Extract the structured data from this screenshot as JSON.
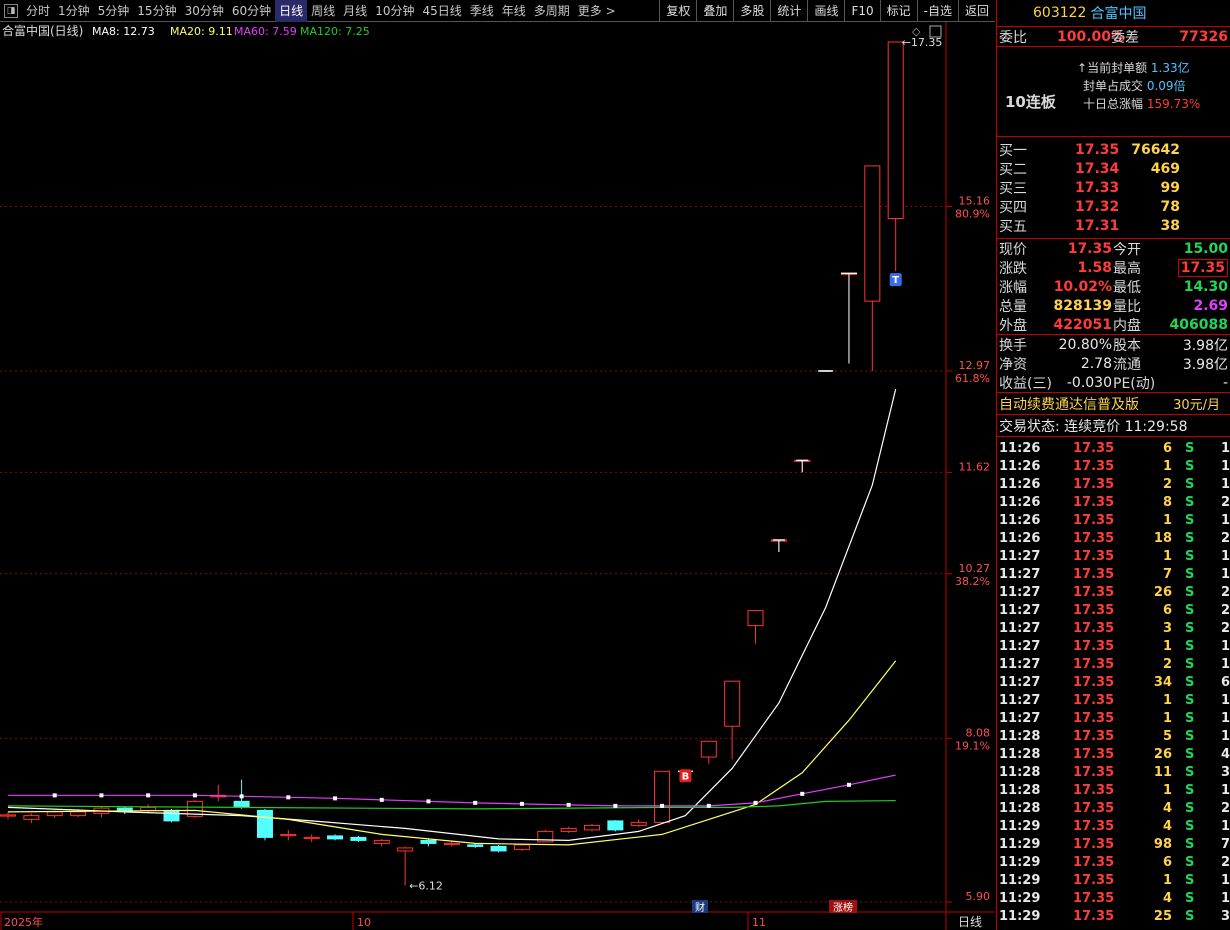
{
  "toolbar": {
    "periods": [
      "分时",
      "1分钟",
      "5分钟",
      "15分钟",
      "30分钟",
      "60分钟",
      "日线",
      "周线",
      "月线",
      "10分钟",
      "45日线",
      "季线",
      "年线",
      "多周期",
      "更多 >"
    ],
    "active_period": "日线",
    "tools": [
      "复权",
      "叠加",
      "多股",
      "统计",
      "画线",
      "F10",
      "标记",
      "-自选",
      "返回"
    ]
  },
  "chart_header": {
    "name": "合富中国(日线)",
    "ma8": "MA8: 12.73",
    "ma20": "MA20: 9.11",
    "ma60": "MA60: 7.59",
    "ma120": "MA120: 7.25"
  },
  "chart_data": {
    "type": "candlestick",
    "ylim": [
      5.9,
      17.35
    ],
    "price_ticks": [
      {
        "v": 15.16,
        "label": "15.16",
        "pct": "80.9%"
      },
      {
        "v": 12.97,
        "label": "12.97",
        "pct": "61.8%"
      },
      {
        "v": 11.62,
        "label": "11.62",
        "pct": ""
      },
      {
        "v": 10.27,
        "label": "10.27",
        "pct": "38.2%"
      },
      {
        "v": 8.08,
        "label": "8.08",
        "pct": "19.1%"
      },
      {
        "v": 5.9,
        "label": "5.90",
        "pct": ""
      }
    ],
    "x_labels": [
      "2025年",
      "10",
      "11"
    ],
    "period_label": "日线",
    "candles": [
      {
        "o": 7.06,
        "c": 7.06,
        "h": 7.1,
        "l": 7.0
      },
      {
        "o": 7.0,
        "c": 7.05,
        "h": 7.08,
        "l": 6.95
      },
      {
        "o": 7.05,
        "c": 7.1,
        "h": 7.12,
        "l": 7.02
      },
      {
        "o": 7.05,
        "c": 7.1,
        "h": 7.14,
        "l": 7.03
      },
      {
        "o": 7.08,
        "c": 7.15,
        "h": 7.17,
        "l": 7.03
      },
      {
        "o": 7.15,
        "c": 7.12,
        "h": 7.17,
        "l": 7.07
      },
      {
        "o": 7.12,
        "c": 7.16,
        "h": 7.2,
        "l": 7.08
      },
      {
        "o": 7.12,
        "c": 6.98,
        "h": 7.14,
        "l": 6.96
      },
      {
        "o": 7.04,
        "c": 7.24,
        "h": 7.26,
        "l": 7.02
      },
      {
        "o": 7.3,
        "c": 7.32,
        "h": 7.46,
        "l": 7.24
      },
      {
        "o": 7.24,
        "c": 7.16,
        "h": 7.53,
        "l": 7.14
      },
      {
        "o": 7.12,
        "c": 6.76,
        "h": 7.14,
        "l": 6.72
      },
      {
        "o": 6.8,
        "c": 6.8,
        "h": 6.86,
        "l": 6.72
      },
      {
        "o": 6.76,
        "c": 6.76,
        "h": 6.8,
        "l": 6.7
      },
      {
        "o": 6.78,
        "c": 6.74,
        "h": 6.8,
        "l": 6.72
      },
      {
        "o": 6.76,
        "c": 6.72,
        "h": 6.78,
        "l": 6.7
      },
      {
        "o": 6.68,
        "c": 6.72,
        "h": 6.74,
        "l": 6.64
      },
      {
        "o": 6.58,
        "c": 6.62,
        "h": 6.64,
        "l": 6.12
      },
      {
        "o": 6.72,
        "c": 6.68,
        "h": 6.74,
        "l": 6.64
      },
      {
        "o": 6.68,
        "c": 6.68,
        "h": 6.72,
        "l": 6.64
      },
      {
        "o": 6.66,
        "c": 6.64,
        "h": 6.68,
        "l": 6.62
      },
      {
        "o": 6.64,
        "c": 6.58,
        "h": 6.66,
        "l": 6.56
      },
      {
        "o": 6.6,
        "c": 6.66,
        "h": 6.68,
        "l": 6.58
      },
      {
        "o": 6.7,
        "c": 6.84,
        "h": 6.86,
        "l": 6.7
      },
      {
        "o": 6.84,
        "c": 6.88,
        "h": 6.9,
        "l": 6.82
      },
      {
        "o": 6.86,
        "c": 6.92,
        "h": 6.94,
        "l": 6.84
      },
      {
        "o": 6.98,
        "c": 6.86,
        "h": 6.99,
        "l": 6.84
      },
      {
        "o": 6.92,
        "c": 6.96,
        "h": 7.0,
        "l": 6.9
      },
      {
        "o": 6.96,
        "c": 7.64,
        "h": 7.64,
        "l": 6.96
      },
      {
        "o": 7.64,
        "c": 7.64,
        "h": 7.64,
        "l": 7.64
      },
      {
        "o": 7.83,
        "c": 8.04,
        "h": 8.04,
        "l": 7.74
      },
      {
        "o": 8.24,
        "c": 8.84,
        "h": 8.84,
        "l": 7.8
      },
      {
        "o": 9.58,
        "c": 9.78,
        "h": 9.78,
        "l": 9.34
      },
      {
        "o": 10.72,
        "c": 10.72,
        "h": 10.72,
        "l": 10.56
      },
      {
        "o": 11.78,
        "c": 11.78,
        "h": 11.78,
        "l": 11.62
      },
      {
        "o": 12.97,
        "c": 12.97,
        "h": 12.97,
        "l": 12.97
      },
      {
        "o": 14.27,
        "c": 14.27,
        "h": 14.27,
        "l": 13.07
      },
      {
        "o": 13.9,
        "c": 15.7,
        "h": 15.7,
        "l": 12.97
      },
      {
        "o": 15.0,
        "c": 17.35,
        "h": 17.35,
        "l": 14.3
      }
    ],
    "ma_lines": [
      {
        "name": "MA8",
        "color": "#ffffff",
        "points": [
          [
            0,
            7.16
          ],
          [
            5,
            7.1
          ],
          [
            10,
            7.05
          ],
          [
            13,
            6.98
          ],
          [
            17,
            6.88
          ],
          [
            21,
            6.74
          ],
          [
            24,
            6.72
          ],
          [
            27,
            6.84
          ],
          [
            29,
            7.05
          ],
          [
            31,
            7.68
          ],
          [
            33,
            8.55
          ],
          [
            35,
            9.82
          ],
          [
            37,
            11.45
          ],
          [
            38,
            12.73
          ]
        ]
      },
      {
        "name": "MA20",
        "color": "#ffff66",
        "points": [
          [
            0,
            7.1
          ],
          [
            8,
            7.12
          ],
          [
            12,
            7.0
          ],
          [
            16,
            6.8
          ],
          [
            20,
            6.68
          ],
          [
            24,
            6.66
          ],
          [
            28,
            6.8
          ],
          [
            30,
            7.0
          ],
          [
            32,
            7.2
          ],
          [
            34,
            7.62
          ],
          [
            36,
            8.32
          ],
          [
            38,
            9.11
          ]
        ]
      },
      {
        "name": "MA60",
        "color": "#e040fb",
        "points": [
          [
            0,
            7.32
          ],
          [
            8,
            7.32
          ],
          [
            14,
            7.28
          ],
          [
            20,
            7.22
          ],
          [
            26,
            7.18
          ],
          [
            30,
            7.18
          ],
          [
            32,
            7.22
          ],
          [
            34,
            7.34
          ],
          [
            36,
            7.46
          ],
          [
            38,
            7.59
          ]
        ]
      },
      {
        "name": "MA120",
        "color": "#22cc22",
        "points": [
          [
            0,
            7.18
          ],
          [
            10,
            7.16
          ],
          [
            20,
            7.14
          ],
          [
            28,
            7.16
          ],
          [
            31,
            7.16
          ],
          [
            33,
            7.18
          ],
          [
            35,
            7.24
          ],
          [
            38,
            7.25
          ]
        ]
      }
    ],
    "annotations": {
      "high": "17.35",
      "low": "6.12",
      "b_marker": "B",
      "t_marker": "T",
      "cai": "财",
      "zhangbang": "涨榜"
    }
  },
  "panel": {
    "code": "603122",
    "name": "合富中国",
    "webi_label": "委比",
    "webi": "100.00%",
    "weicha_label": "委差",
    "weicha": "77326",
    "seal_amt_label": "当前封单额",
    "seal_amt": "1.33亿",
    "seal_ratio_label": "封单占成交",
    "seal_ratio": "0.09倍",
    "tenday_label": "十日总涨幅",
    "tenday": "159.73%",
    "lianban": "10连板",
    "bids": [
      {
        "label": "买一",
        "price": "17.35",
        "vol": "76642"
      },
      {
        "label": "买二",
        "price": "17.34",
        "vol": "469"
      },
      {
        "label": "买三",
        "price": "17.33",
        "vol": "99"
      },
      {
        "label": "买四",
        "price": "17.32",
        "vol": "78"
      },
      {
        "label": "买五",
        "price": "17.31",
        "vol": "38"
      }
    ],
    "q": [
      {
        "l1": "现价",
        "v1": "17.35",
        "c1": "red",
        "l2": "今开",
        "v2": "15.00",
        "c2": "green"
      },
      {
        "l1": "涨跌",
        "v1": "1.58",
        "c1": "red",
        "l2": "最高",
        "v2": "17.35",
        "c2": "red"
      },
      {
        "l1": "涨幅",
        "v1": "10.02%",
        "c1": "red",
        "l2": "最低",
        "v2": "14.30",
        "c2": "green"
      },
      {
        "l1": "总量",
        "v1": "828139",
        "c1": "yel",
        "l2": "量比",
        "v2": "2.69",
        "c2": "mag"
      },
      {
        "l1": "外盘",
        "v1": "422051",
        "c1": "red",
        "l2": "内盘",
        "v2": "406088",
        "c2": "green"
      }
    ],
    "f": [
      {
        "l1": "换手",
        "v1": "20.80%",
        "l2": "股本",
        "v2": "3.98亿"
      },
      {
        "l1": "净资",
        "v1": "2.78",
        "l2": "流通",
        "v2": "3.98亿"
      },
      {
        "l1": "收益(三)",
        "v1": "-0.030",
        "l2": "PE(动)",
        "v2": "-"
      }
    ],
    "promo": "自动续费通达信普及版",
    "promo_price": "30元/月",
    "trade_state": "交易状态: 连续竞价 11:29:58",
    "ticks": [
      [
        "11:26",
        "17.35",
        "6",
        "S",
        "1"
      ],
      [
        "11:26",
        "17.35",
        "1",
        "S",
        "1"
      ],
      [
        "11:26",
        "17.35",
        "2",
        "S",
        "1"
      ],
      [
        "11:26",
        "17.35",
        "8",
        "S",
        "2"
      ],
      [
        "11:26",
        "17.35",
        "1",
        "S",
        "1"
      ],
      [
        "11:26",
        "17.35",
        "18",
        "S",
        "2"
      ],
      [
        "11:27",
        "17.35",
        "1",
        "S",
        "1"
      ],
      [
        "11:27",
        "17.35",
        "7",
        "S",
        "1"
      ],
      [
        "11:27",
        "17.35",
        "26",
        "S",
        "2"
      ],
      [
        "11:27",
        "17.35",
        "6",
        "S",
        "2"
      ],
      [
        "11:27",
        "17.35",
        "3",
        "S",
        "2"
      ],
      [
        "11:27",
        "17.35",
        "1",
        "S",
        "1"
      ],
      [
        "11:27",
        "17.35",
        "2",
        "S",
        "1"
      ],
      [
        "11:27",
        "17.35",
        "34",
        "S",
        "6"
      ],
      [
        "11:27",
        "17.35",
        "1",
        "S",
        "1"
      ],
      [
        "11:27",
        "17.35",
        "1",
        "S",
        "1"
      ],
      [
        "11:28",
        "17.35",
        "5",
        "S",
        "1"
      ],
      [
        "11:28",
        "17.35",
        "26",
        "S",
        "4"
      ],
      [
        "11:28",
        "17.35",
        "11",
        "S",
        "3"
      ],
      [
        "11:28",
        "17.35",
        "1",
        "S",
        "1"
      ],
      [
        "11:28",
        "17.35",
        "4",
        "S",
        "2"
      ],
      [
        "11:29",
        "17.35",
        "4",
        "S",
        "1"
      ],
      [
        "11:29",
        "17.35",
        "98",
        "S",
        "7"
      ],
      [
        "11:29",
        "17.35",
        "6",
        "S",
        "2"
      ],
      [
        "11:29",
        "17.35",
        "1",
        "S",
        "1"
      ],
      [
        "11:29",
        "17.35",
        "4",
        "S",
        "1"
      ],
      [
        "11:29",
        "17.35",
        "25",
        "S",
        "3"
      ]
    ]
  }
}
